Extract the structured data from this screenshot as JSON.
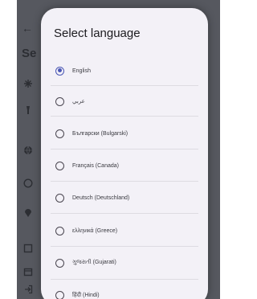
{
  "background": {
    "back_glyph": "←",
    "title": "Se",
    "icons": [
      "translate-icon",
      "flashlight-icon",
      "globe-icon",
      "info-icon",
      "location-icon",
      "save-icon",
      "calendar-icon",
      "login-icon"
    ]
  },
  "dialog": {
    "title": "Select language",
    "selected": "English",
    "options": [
      "English",
      "عربي",
      "Български (Bulgarski)",
      "Français (Canada)",
      "Deutsch (Deutschland)",
      "ελληνικά (Greece)",
      "ગુજરાતી (Gujarati)",
      "हिंदी (Hindi)"
    ]
  },
  "colors": {
    "accent": "#4a57b5",
    "dialog_background": "#f3f1f7",
    "scrim": "#56585f"
  }
}
